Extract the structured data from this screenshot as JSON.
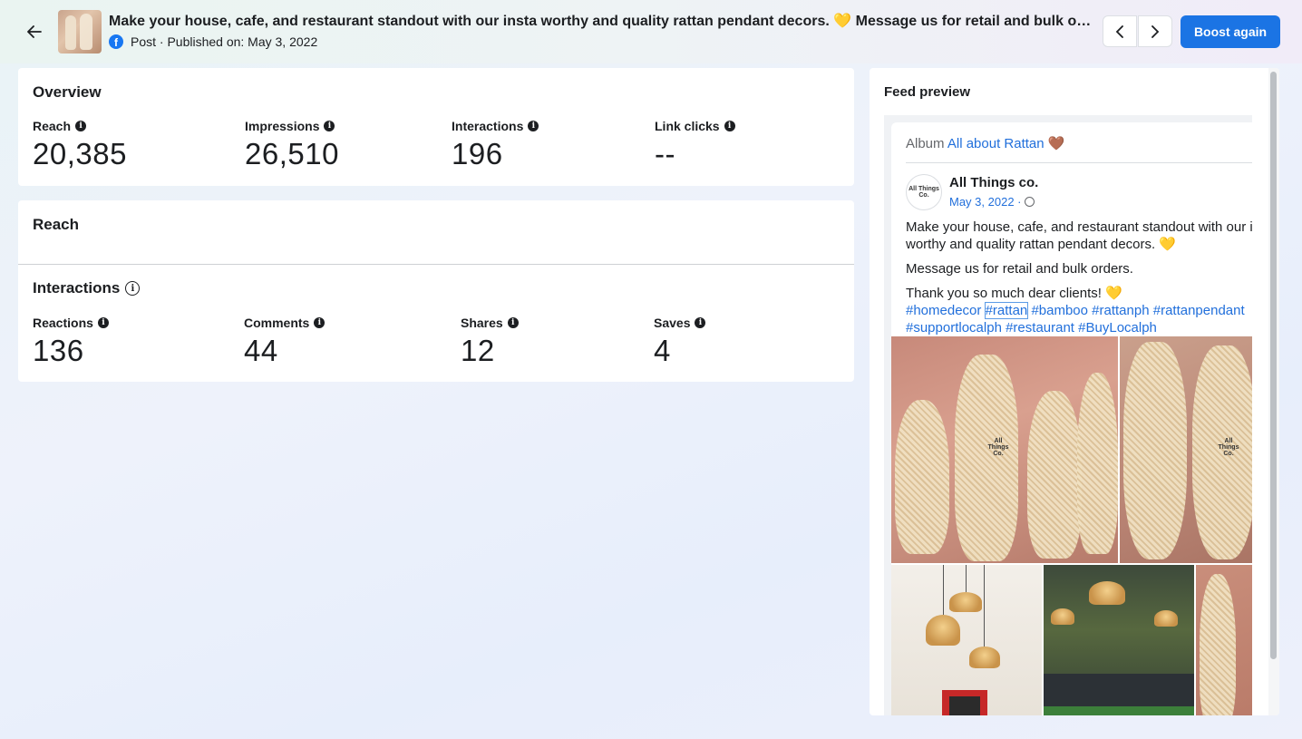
{
  "header": {
    "title": "Make your house, cafe, and restaurant standout with our insta worthy and quality rattan pendant decors. 💛 Message us for retail and bulk or...",
    "meta": "Post · Published on: May 3, 2022",
    "boost_label": "Boost again"
  },
  "overview": {
    "title": "Overview",
    "metrics": [
      {
        "label": "Reach",
        "value": "20,385"
      },
      {
        "label": "Impressions",
        "value": "26,510"
      },
      {
        "label": "Interactions",
        "value": "196"
      },
      {
        "label": "Link clicks",
        "value": "--"
      }
    ]
  },
  "reach_section": {
    "title": "Reach"
  },
  "interactions": {
    "title": "Interactions",
    "metrics": [
      {
        "label": "Reactions",
        "value": "136"
      },
      {
        "label": "Comments",
        "value": "44"
      },
      {
        "label": "Shares",
        "value": "12"
      },
      {
        "label": "Saves",
        "value": "4"
      }
    ]
  },
  "feed_preview": {
    "title": "Feed preview",
    "album_prefix": "Album",
    "album_name": "All about Rattan",
    "album_emoji": "🤎",
    "page_name": "All Things co.",
    "avatar_text": "All Things Co.",
    "date": "May 3, 2022 ·",
    "text_line1": "Make your house, cafe, and restaurant standout with our insta",
    "text_line2": "worthy and quality rattan pendant decors. 💛",
    "text_para2": "Message us for retail and bulk orders.",
    "text_para3": "Thank you so much dear clients! 💛",
    "hashtags": {
      "h1": "#homedecor",
      "h2": "#rattan",
      "h3": "#bamboo",
      "h4": "#rattanph",
      "h5": "#rattanpendant",
      "h6": "#supportlocalph",
      "h7": "#restaurant",
      "h8": "#BuyLocalph"
    },
    "watermark": "All Things Co."
  }
}
